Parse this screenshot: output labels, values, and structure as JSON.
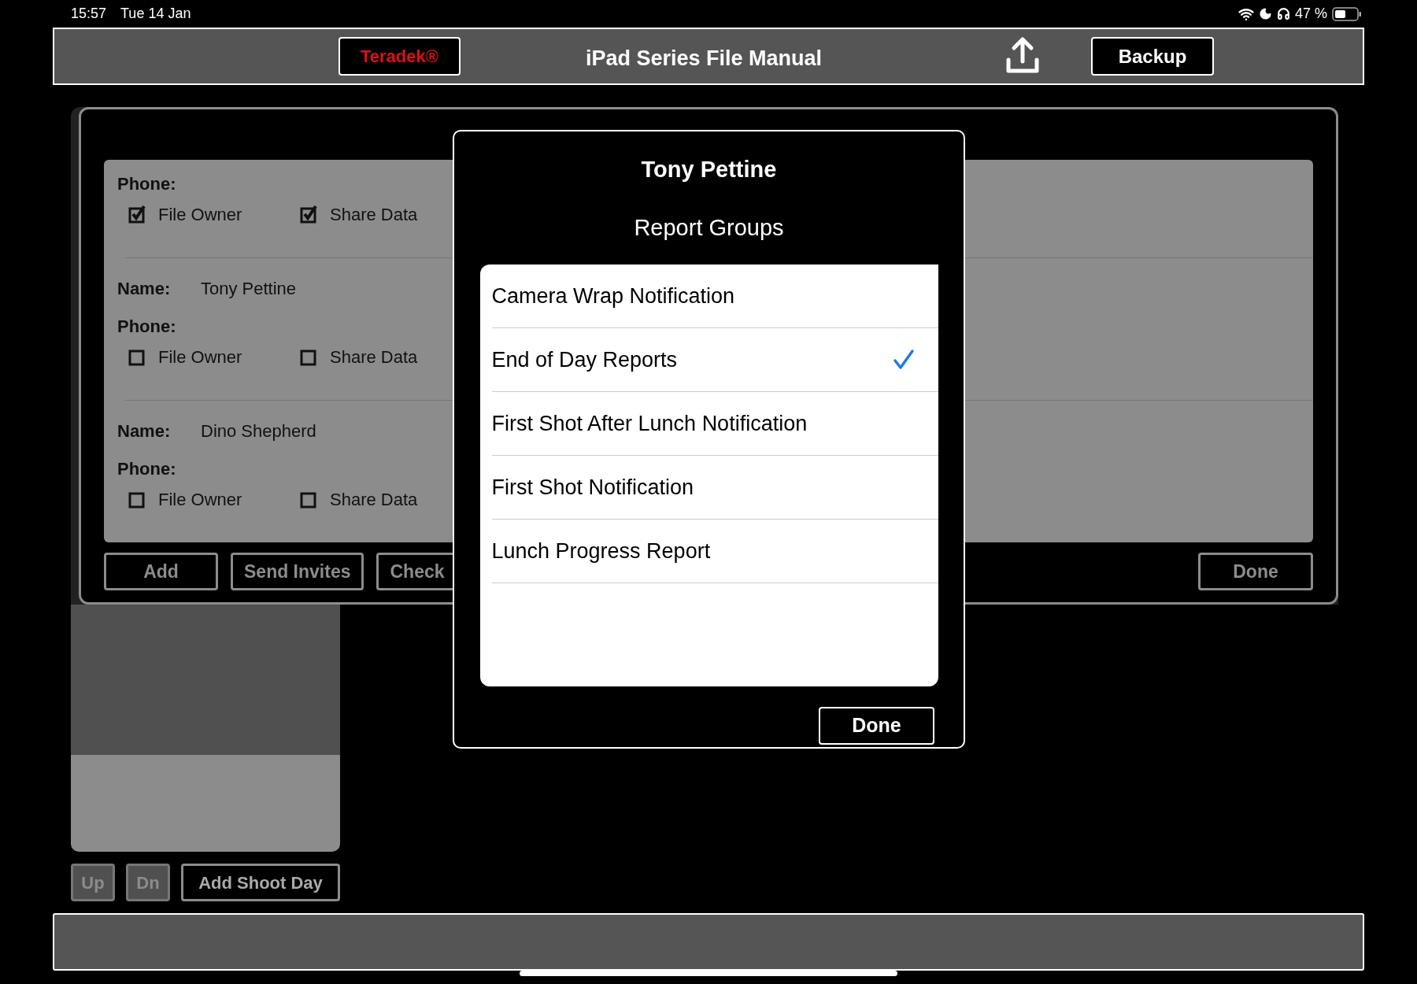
{
  "status_bar": {
    "time": "15:57",
    "date": "Tue 14 Jan",
    "battery": "47 %"
  },
  "toolbar": {
    "brand": "Teradek®",
    "title": "iPad Series File Manual",
    "backup": "Backup"
  },
  "participants": [
    {
      "phone_label": "Phone:",
      "options": [
        {
          "label": "File Owner",
          "checked": true
        },
        {
          "label": "Share Data",
          "checked": true
        }
      ]
    },
    {
      "name_label": "Name:",
      "name": "Tony Pettine",
      "phone_label": "Phone:",
      "options": [
        {
          "label": "File Owner",
          "checked": false
        },
        {
          "label": "Share Data",
          "checked": false
        }
      ]
    },
    {
      "name_label": "Name:",
      "name": "Dino Shepherd",
      "phone_label": "Phone:",
      "options": [
        {
          "label": "File Owner",
          "checked": false
        },
        {
          "label": "Share Data",
          "checked": false
        }
      ]
    }
  ],
  "panel_buttons": [
    "Add",
    "Send Invites",
    "Check"
  ],
  "panel_done": "Done",
  "day_buttons": [
    {
      "label": "Up",
      "disabled": true
    },
    {
      "label": "Dn",
      "disabled": true
    },
    {
      "label": "Add Shoot Day",
      "disabled": false
    }
  ],
  "dialog": {
    "title": "Tony Pettine",
    "subtitle": "Report Groups",
    "groups": [
      {
        "label": "Camera Wrap Notification",
        "checked": false
      },
      {
        "label": "End of Day Reports",
        "checked": true
      },
      {
        "label": "First Shot After Lunch Notification",
        "checked": false
      },
      {
        "label": "First Shot Notification",
        "checked": false
      },
      {
        "label": "Lunch Progress Report",
        "checked": false
      }
    ],
    "done": "Done"
  }
}
